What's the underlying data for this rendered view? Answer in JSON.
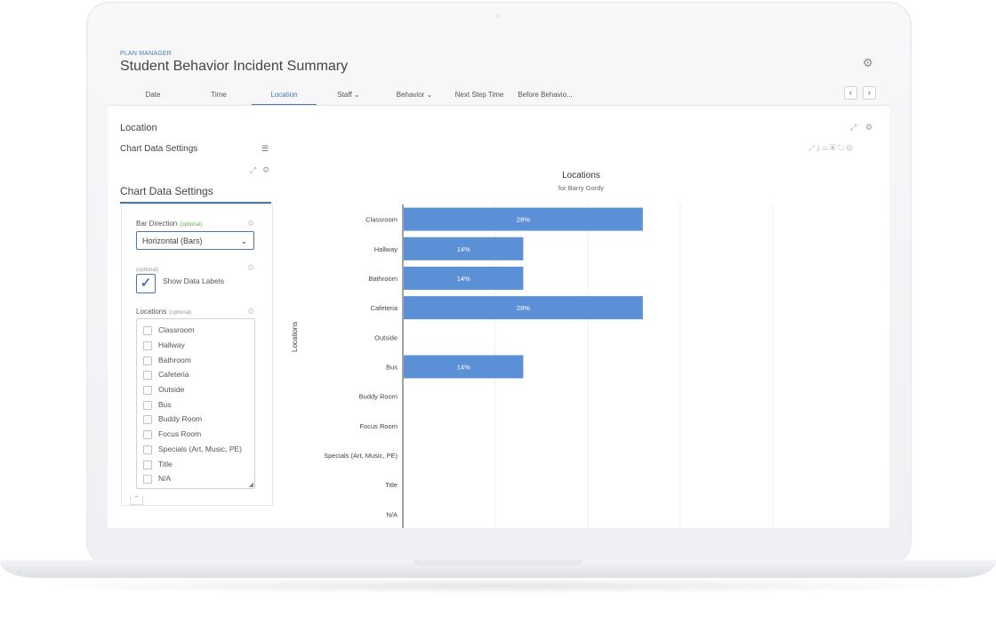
{
  "header": {
    "kicker": "PLAN MANAGER",
    "title": "Student Behavior Incident Summary"
  },
  "tabs": [
    {
      "label": "Date",
      "active": false
    },
    {
      "label": "Time",
      "active": false
    },
    {
      "label": "Location",
      "active": true
    },
    {
      "label": "Staff",
      "active": false,
      "has_dropdown": true
    },
    {
      "label": "Behavior",
      "active": false,
      "has_dropdown": true
    },
    {
      "label": "Next Step Time",
      "active": false
    },
    {
      "label": "Before Behavio...",
      "active": false
    }
  ],
  "nav": {
    "prev_icon": "‹",
    "next_icon": "›"
  },
  "section": {
    "title": "Location",
    "chart_data_settings_label": "Chart Data Settings"
  },
  "settings_panel": {
    "title": "Chart Data Settings",
    "bar_direction": {
      "label": "Bar Direction",
      "optional": "(optional)",
      "value": "Horizontal (Bars)"
    },
    "data_labels": {
      "optional": "(optional)",
      "label": "Show Data Labels",
      "checked": true
    },
    "locations": {
      "label": "Locations",
      "optional": "(optional)",
      "items": [
        "Classroom",
        "Hallway",
        "Bathroom",
        "Cafeteria",
        "Outside",
        "Bus",
        "Buddy Room",
        "Focus Room",
        "Specials (Art, Music, PE)",
        "Title",
        "N/A"
      ]
    }
  },
  "icons": {
    "gear": "gear-icon",
    "expand": "expand-icon",
    "list": "list-icon",
    "check": "checkmark-icon",
    "chevron_down": "chevron-down-icon"
  },
  "colors": {
    "accent": "#4a77b4",
    "bar": "#5b8fd6",
    "optional_green": "#6aa84f"
  },
  "chart_data": {
    "type": "bar",
    "orientation": "horizontal",
    "title": "Locations",
    "subtitle": "for  Barry Gordy",
    "ylabel": "Locations",
    "categories": [
      "Classroom",
      "Hallway",
      "Bathroom",
      "Cafeteria",
      "Outside",
      "Bus",
      "Buddy Room",
      "Focus Room",
      "Specials (Art, Music, PE)",
      "Title",
      "N/A"
    ],
    "values": [
      28,
      14,
      14,
      28,
      0,
      14,
      0,
      0,
      0,
      0,
      0
    ],
    "data_labels": [
      "28%",
      "14%",
      "14%",
      "28%",
      "",
      "14%",
      "",
      "",
      "",
      "",
      ""
    ],
    "xlim": [
      0,
      100
    ],
    "grid": true
  }
}
